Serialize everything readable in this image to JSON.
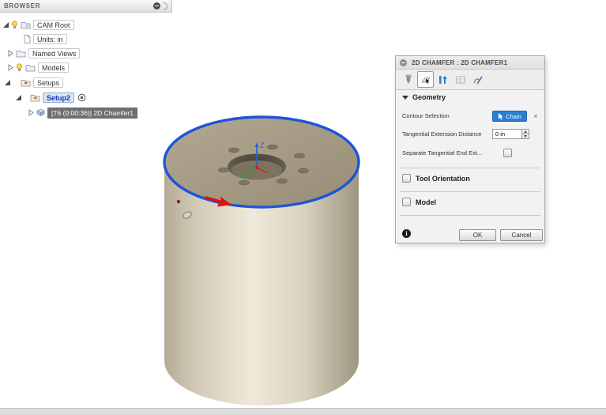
{
  "browser": {
    "title": "BROWSER",
    "items": [
      {
        "label": "CAM Root"
      },
      {
        "label": "Units: in"
      },
      {
        "label": "Named Views"
      },
      {
        "label": "Models"
      },
      {
        "label": "Setups"
      },
      {
        "label": "Setup2"
      },
      {
        "label": "[T6 (0:00:36)] 2D Chamfer1"
      }
    ]
  },
  "viewport": {
    "axis_label_z": "Z"
  },
  "dialog": {
    "title": "2D CHAMFER : 2D CHAMFER1",
    "tabs": [
      {
        "name": "tool-tab",
        "selected": false
      },
      {
        "name": "geometry-tab",
        "selected": true
      },
      {
        "name": "heights-tab",
        "selected": false
      },
      {
        "name": "passes-tab",
        "selected": false
      },
      {
        "name": "linking-tab",
        "selected": false
      }
    ],
    "geometry_section": {
      "label": "Geometry",
      "contour_selection": {
        "label": "Contour Selection",
        "button_label": "Chain"
      },
      "tangential_extension": {
        "label": "Tangential Extension Distance",
        "value": "0 in"
      },
      "separate_tangential": {
        "label": "Separate Tangential End Ext...",
        "checked": false
      }
    },
    "tool_orientation_section": {
      "label": "Tool Orientation",
      "checked": false
    },
    "model_section": {
      "label": "Model",
      "checked": false
    },
    "footer": {
      "ok": "OK",
      "cancel": "Cancel"
    }
  },
  "icons": {
    "clear": "×",
    "info": "i"
  },
  "colors": {
    "accent_blue": "#2a7ed2",
    "chain_selection_highlight": "#1d54d8",
    "selected_operation_row_bg": "#6f6f6f",
    "setup_selected_text": "#1133bb",
    "cylinder_top": "#a69c87",
    "cylinder_body_light": "#efe9da"
  }
}
